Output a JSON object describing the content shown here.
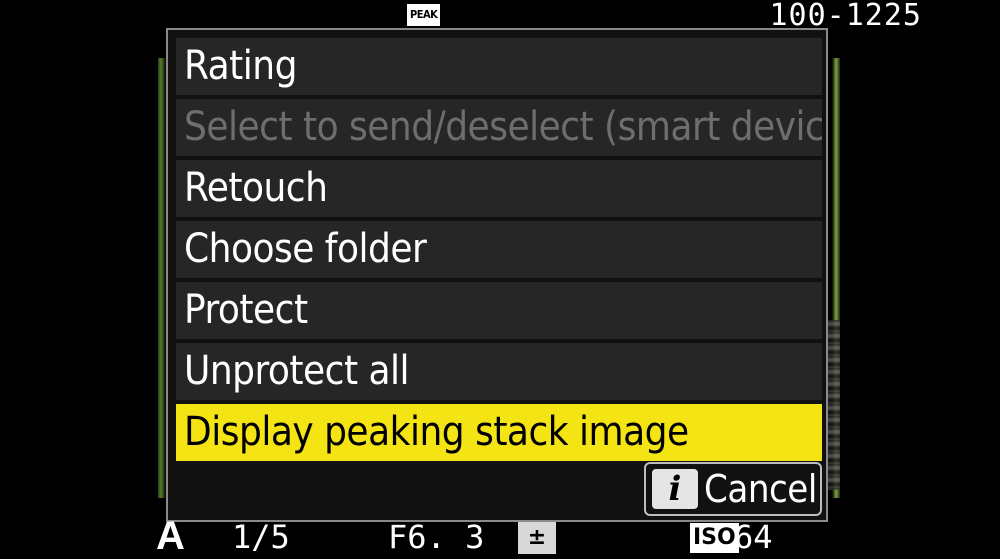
{
  "status_top": {
    "peak_badge": "PEAK",
    "file_number": "100-1225"
  },
  "menu": {
    "items": [
      {
        "label": "Rating",
        "state": "enabled"
      },
      {
        "label": "Select to send/deselect (smart device)",
        "state": "disabled"
      },
      {
        "label": "Retouch",
        "state": "enabled"
      },
      {
        "label": "Choose folder",
        "state": "enabled"
      },
      {
        "label": "Protect",
        "state": "enabled"
      },
      {
        "label": "Unprotect all",
        "state": "enabled"
      },
      {
        "label": "Display peaking stack image",
        "state": "selected"
      }
    ],
    "cancel": {
      "icon_glyph": "i",
      "icon_name": "info-icon",
      "label": "Cancel"
    }
  },
  "status_bottom": {
    "mode": "A",
    "shutter": "1/5",
    "aperture": "F6. 3",
    "exposure_comp_glyph": "±",
    "iso_badge": "ISO",
    "iso_value": "64"
  },
  "colors": {
    "highlight": "#f5e414",
    "item_bg": "#262626",
    "disabled_text": "#6e6e6e",
    "panel_border": "#8a8a8a"
  }
}
